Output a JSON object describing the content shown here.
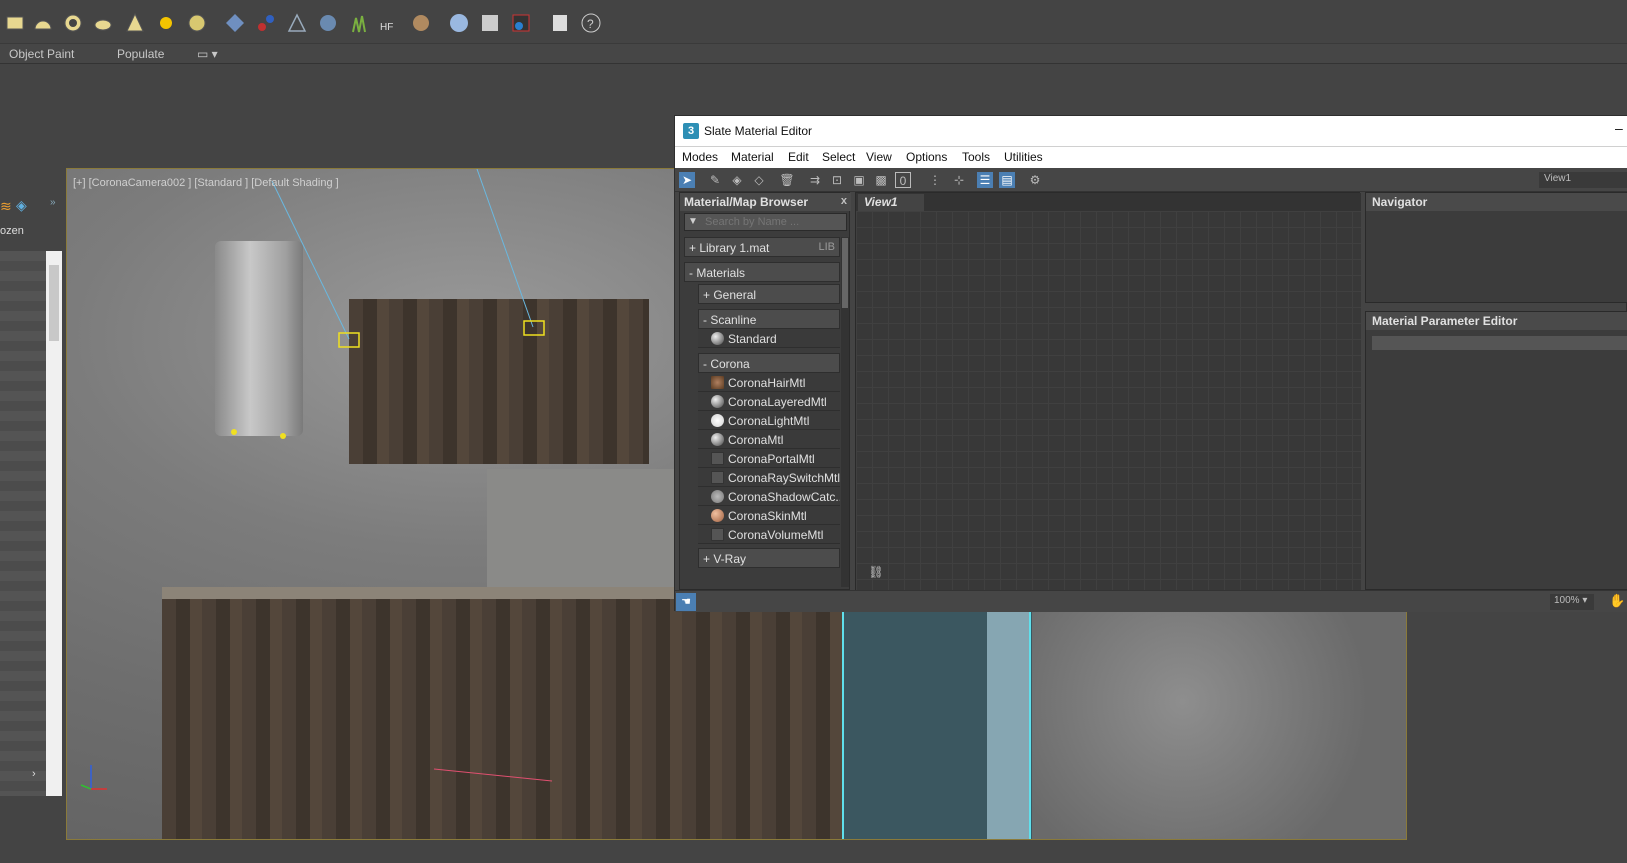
{
  "toolbar": {
    "icons": [
      "plane-icon",
      "hemisphere-icon",
      "torus-icon",
      "teapot-icon",
      "cone-icon",
      "sun-icon",
      "sphere-icon",
      "grid-icon",
      "molecule-icon",
      "angle-icon",
      "gear-icon",
      "grass-icon",
      "hair-fur-icon",
      "fiber-icon",
      "material-sphere-icon",
      "render-setup-icon",
      "render-frame-icon",
      "panel-icon",
      "help-icon"
    ]
  },
  "ribbon": {
    "object_paint": "Object Paint",
    "populate": "Populate"
  },
  "explorer": {
    "column_label": "ozen"
  },
  "viewport": {
    "label": "[+] [CoronaCamera002 ] [Standard ] [Default Shading ]"
  },
  "slate": {
    "title": "Slate Material Editor",
    "title_icon": "3",
    "menus": [
      "Modes",
      "Material",
      "Edit",
      "Select",
      "View",
      "Options",
      "Tools",
      "Utilities"
    ],
    "view_select": "View1",
    "browser": {
      "header": "Material/Map Browser",
      "close": "x",
      "search_placeholder": "Search by Name ...",
      "library": "+ Library 1.mat",
      "library_tag": "LIB",
      "materials": "- Materials",
      "general": "+ General",
      "scanline": "- Scanline",
      "standard": "Standard",
      "corona": "- Corona",
      "corona_items": [
        "CoronaHairMtl",
        "CoronaLayeredMtl",
        "CoronaLightMtl",
        "CoronaMtl",
        "CoronaPortalMtl",
        "CoronaRaySwitchMtl",
        "CoronaShadowCatc...",
        "CoronaSkinMtl",
        "CoronaVolumeMtl"
      ],
      "vray": "+ V-Ray"
    },
    "view_tab": "View1",
    "navigator": "Navigator",
    "param_editor": "Material Parameter Editor",
    "zoom": "100%"
  }
}
